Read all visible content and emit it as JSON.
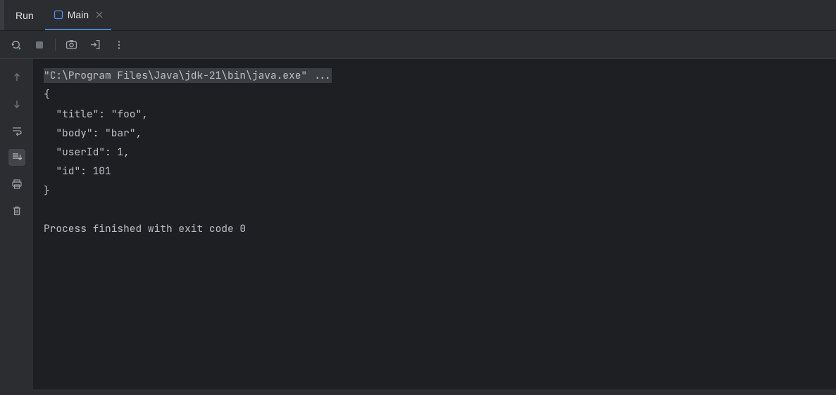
{
  "header": {
    "title": "Run",
    "tab": {
      "label": "Main"
    }
  },
  "console": {
    "command": "\"C:\\Program Files\\Java\\jdk-21\\bin\\java.exe\" ...",
    "output_lines": [
      "{",
      "  \"title\": \"foo\",",
      "  \"body\": \"bar\",",
      "  \"userId\": 1,",
      "  \"id\": 101",
      "}",
      "",
      "Process finished with exit code 0"
    ]
  }
}
